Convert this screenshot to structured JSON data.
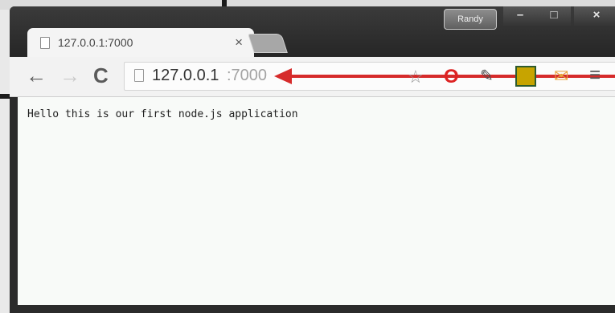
{
  "tab": {
    "title": "127.0.0.1:7000",
    "close_glyph": "×",
    "icon": "page-icon"
  },
  "profile": {
    "label": "Randy"
  },
  "window_controls": {
    "minimize": "–",
    "maximize": "□",
    "close": "×"
  },
  "toolbar": {
    "back_glyph": "←",
    "forward_glyph": "→",
    "reload_glyph": "C",
    "url_host": "127.0.0.1",
    "url_port": ":7000",
    "icons": [
      "star-icon",
      "opera-icon",
      "tool-icon",
      "extension-icon",
      "extension-icon",
      "menu-icon"
    ],
    "star_glyph": "☆",
    "opera_glyph": "O",
    "tool_glyph": "✎",
    "ext2_glyph": "✉",
    "menu_glyph": "≡"
  },
  "annotation": {
    "arrow_color": "#d62b2b"
  },
  "page": {
    "text": "Hello this is our first node.js application"
  }
}
